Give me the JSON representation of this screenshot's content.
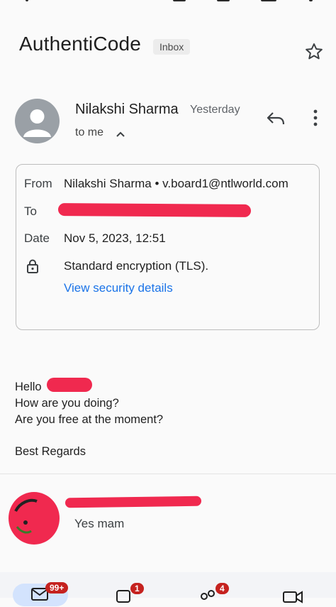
{
  "header": {
    "subject": "AuthentiCode",
    "label": "Inbox"
  },
  "message": {
    "sender_name": "Nilakshi Sharma",
    "time": "Yesterday",
    "to_me": "to me"
  },
  "details": {
    "from_label": "From",
    "from_value": "Nilakshi Sharma • v.board1@ntlworld.com",
    "to_label": "To",
    "date_label": "Date",
    "date_value": "Nov 5, 2023, 12:51",
    "encryption_text": "Standard encryption (TLS).",
    "security_link": "View security details"
  },
  "body": {
    "line1": "Hello",
    "line2": "How are you doing?",
    "line3": "Are you free at the moment?",
    "line4": "Best Regards"
  },
  "reply": {
    "preview": "Yes mam"
  },
  "nav": {
    "mail_badge": "99+",
    "chat_badge": "1",
    "spaces_badge": "4"
  },
  "colors": {
    "accent_link": "#1a73e8",
    "redaction": "#f0294f",
    "badge": "#c5221f"
  }
}
